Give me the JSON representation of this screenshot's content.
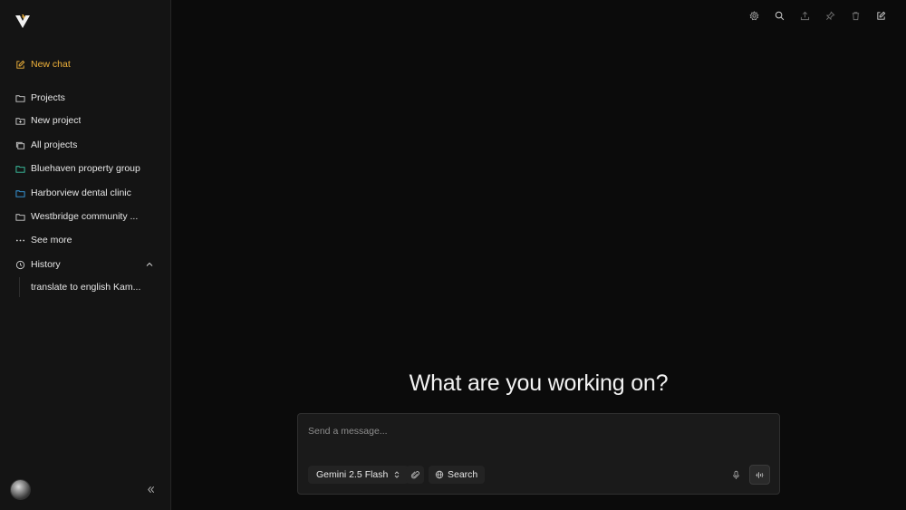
{
  "sidebar": {
    "new_chat": "New chat",
    "items": [
      {
        "label": "Projects",
        "icon": "folder-icon"
      },
      {
        "label": "New project",
        "icon": "folder-plus-icon"
      },
      {
        "label": "All projects",
        "icon": "folders-icon"
      },
      {
        "label": "Bluehaven property group",
        "icon": "folder-icon",
        "color": "#3cc8a6"
      },
      {
        "label": "Harborview dental clinic",
        "icon": "folder-icon",
        "color": "#3aa0e8"
      },
      {
        "label": "Westbridge community ...",
        "icon": "folder-icon"
      },
      {
        "label": "See more",
        "icon": "ellipsis-icon"
      }
    ],
    "history": {
      "label": "History",
      "entries": [
        "translate to english Kam..."
      ]
    }
  },
  "main": {
    "heading": "What are you working on?",
    "composer": {
      "placeholder": "Send a message...",
      "model": "Gemini 2.5 Flash",
      "search_label": "Search"
    }
  },
  "colors": {
    "accent": "#f0b23a",
    "background": "#0b0b0b",
    "sidebar": "#141414"
  }
}
